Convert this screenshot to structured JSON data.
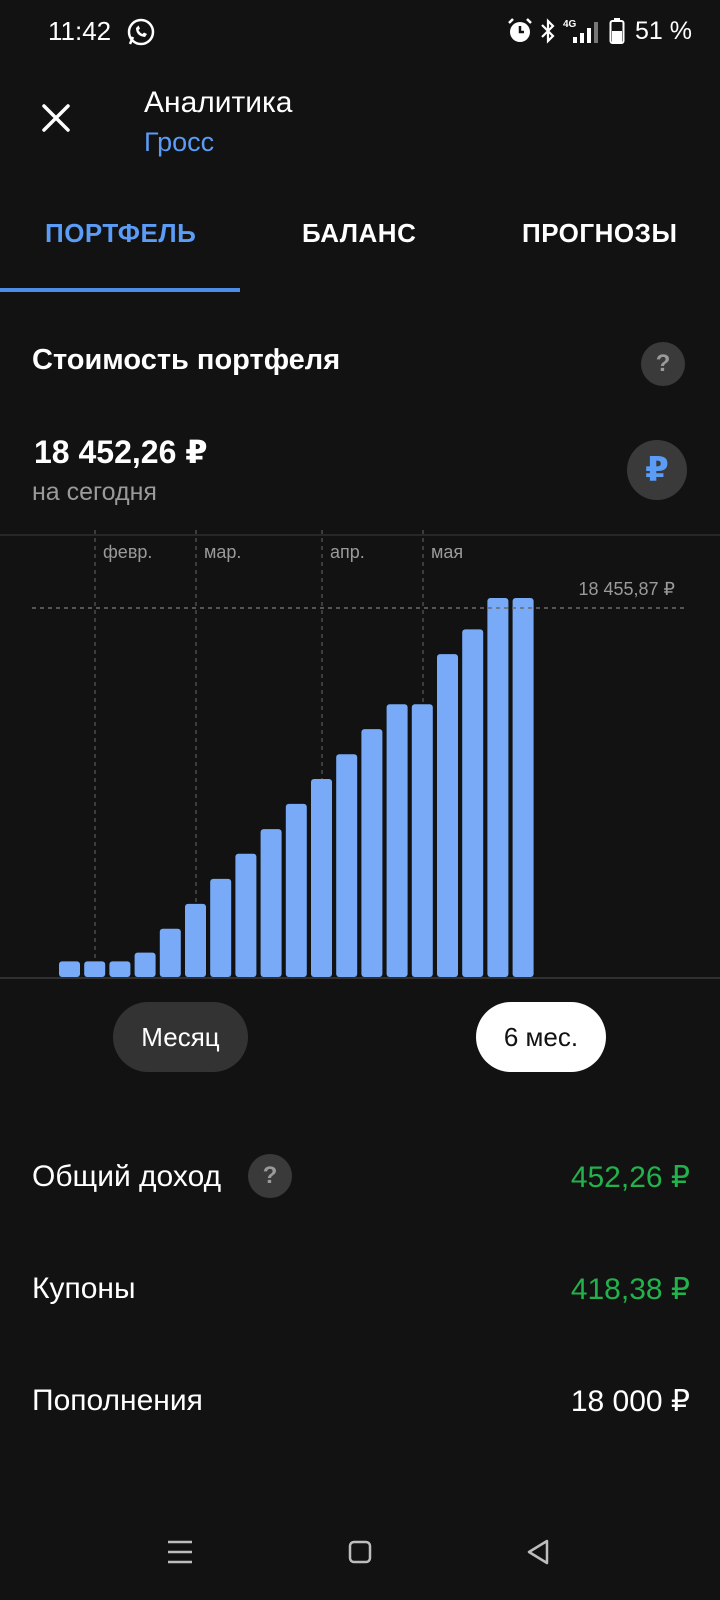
{
  "status_bar": {
    "time": "11:42",
    "battery": "51 %",
    "icons": [
      "whatsapp-icon",
      "alarm-icon",
      "bluetooth-icon",
      "signal-4g-icon",
      "battery-icon"
    ]
  },
  "header": {
    "title": "Аналитика",
    "subtitle": "Гросс"
  },
  "tabs": [
    {
      "label": "ПОРТФЕЛЬ",
      "active": true
    },
    {
      "label": "БАЛАНС",
      "active": false
    },
    {
      "label": "ПРОГНОЗЫ",
      "active": false
    }
  ],
  "portfolio": {
    "section_title": "Стоимость портфеля",
    "value": "18 452,26 ₽",
    "value_caption": "на сегодня",
    "currency_symbol": "₽"
  },
  "chart_data": {
    "type": "bar",
    "month_labels": [
      "февр.",
      "мар.",
      "апр.",
      "мая"
    ],
    "max_label": "18 455,87 ₽",
    "max_value": 18455.87,
    "values": [
      760,
      760,
      760,
      1190,
      2350,
      3560,
      4780,
      6000,
      7200,
      8430,
      9640,
      10850,
      12070,
      13280,
      13280,
      15720,
      16930,
      18455.87,
      18455.87
    ],
    "ylim": [
      0,
      18455.87
    ],
    "bar_color": "#78aaf8"
  },
  "periods": {
    "month": "Месяц",
    "six_months": "6 мес.",
    "selected": "six_months"
  },
  "stats": [
    {
      "label": "Общий доход",
      "value": "452,26 ₽",
      "color": "#22b24c",
      "has_help": true
    },
    {
      "label": "Купоны",
      "value": "418,38 ₽",
      "color": "#22b24c",
      "has_help": false
    },
    {
      "label": "Пополнения",
      "value": "18 000 ₽",
      "color": "#ffffff",
      "has_help": false
    }
  ],
  "help_symbol": "?",
  "nav": {
    "icons": [
      "menu-icon",
      "home-icon",
      "back-icon"
    ]
  }
}
